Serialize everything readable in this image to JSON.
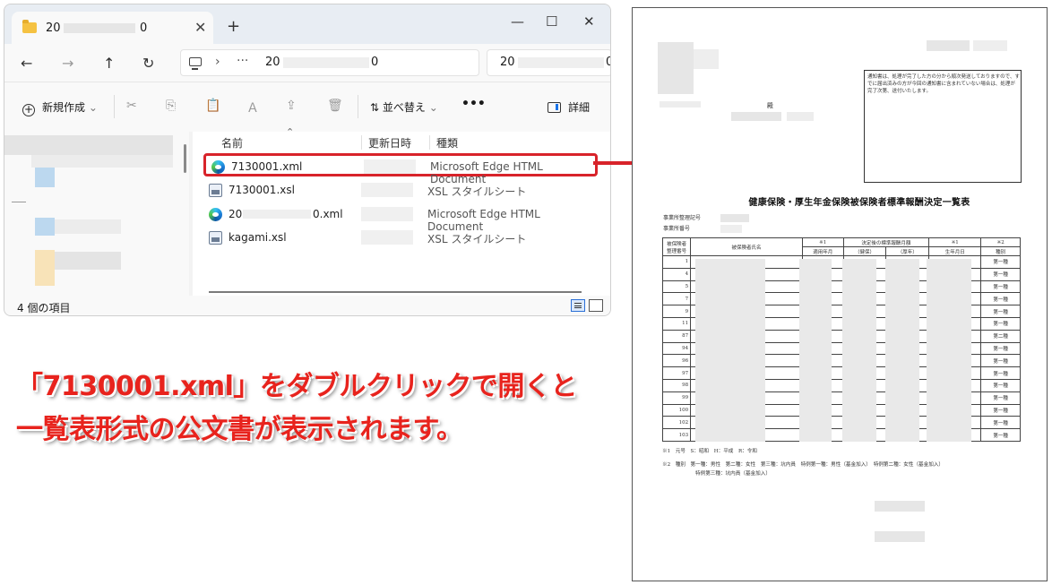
{
  "explorer": {
    "tab": {
      "title_prefix": "20",
      "title_suffix": "0",
      "close": "✕",
      "new_tab": "+"
    },
    "window_controls": {
      "minimize": "—",
      "maximize": "☐",
      "close": "✕"
    },
    "nav": {
      "back": "←",
      "forward": "→",
      "up": "↑",
      "refresh": "↻"
    },
    "address": {
      "separator": "›",
      "more": "···",
      "path_prefix": "20",
      "path_suffix": "0"
    },
    "search": {
      "prefix": "20",
      "suffix": "0"
    },
    "toolbar": {
      "new_label": "新規作成",
      "new_plus": "+",
      "new_caret": "⌄",
      "cut_icon": "✂",
      "copy_icon": "⎘",
      "paste_icon": "📋",
      "rename_icon": "Ａ",
      "share_icon": "⇪",
      "delete_icon": "🗑",
      "sort_label": "並べ替え",
      "sort_icon": "⇅",
      "sort_caret": "⌄",
      "more": "•••",
      "details_label": "詳細"
    },
    "columns": {
      "name": "名前",
      "modified": "更新日時",
      "type": "種類",
      "sort_caret": "⌃"
    },
    "files": [
      {
        "name": "7130001.xml",
        "name_suffix": "",
        "type": "Microsoft Edge HTML Document",
        "icon": "edge-icon",
        "selected": true
      },
      {
        "name": "7130001.xsl",
        "name_suffix": "",
        "type": "XSL スタイルシート",
        "icon": "xsl-icon",
        "selected": false
      },
      {
        "name": "20",
        "name_suffix": "0.xml",
        "type": "Microsoft Edge HTML Document",
        "icon": "edge-icon",
        "selected": false
      },
      {
        "name": "kagami.xsl",
        "name_suffix": "",
        "type": "XSL スタイルシート",
        "icon": "xsl-icon",
        "selected": false
      }
    ],
    "status": {
      "count": "4 個の項目"
    }
  },
  "caption": {
    "line1": "「7130001.xml」をダブルクリックで開くと",
    "line2": "一覧表形式の公文書が表示されます。"
  },
  "document": {
    "recipient_suffix": "殿",
    "notice": "通知書は、処理が完了した方の分から順次発送しておりますので、すでに届出済みの方が今回の通知書に含まれていない場合は、処理が完了次第、送付いたします。",
    "title": "健康保険・厚生年金保険被保険者標準報酬決定一覧表",
    "office_code_label": "事業所整理記号",
    "office_number_label": "事業所番号",
    "header": {
      "insured_number": "被保険者\n整理番号",
      "insured_name": "被保険者氏名",
      "note1a": "※1",
      "applicable_month": "適用年月",
      "decided_std": "決定後の標準報酬月額",
      "health": "（健保）",
      "pension": "（厚年）",
      "note1b": "※1",
      "birth_date": "生年月日",
      "note2": "※2",
      "kind": "種別"
    },
    "rows": [
      {
        "no": "1",
        "kind": "第一種"
      },
      {
        "no": "4",
        "kind": "第一種"
      },
      {
        "no": "5",
        "kind": "第一種"
      },
      {
        "no": "7",
        "kind": "第一種"
      },
      {
        "no": "9",
        "kind": "第一種"
      },
      {
        "no": "11",
        "kind": "第一種"
      },
      {
        "no": "87",
        "kind": "第二種"
      },
      {
        "no": "94",
        "kind": "第一種"
      },
      {
        "no": "96",
        "kind": "第一種"
      },
      {
        "no": "97",
        "kind": "第一種"
      },
      {
        "no": "98",
        "kind": "第一種"
      },
      {
        "no": "99",
        "kind": "第一種"
      },
      {
        "no": "100",
        "kind": "第一種"
      },
      {
        "no": "102",
        "kind": "第一種"
      },
      {
        "no": "103",
        "kind": "第一種"
      }
    ],
    "footnote1": "※1　元号　S：昭和　H：平成　R：令和",
    "footnote2": "※2　種別　第一種：男性　第二種：女性　第三種：坑内員　特例第一種：男性（基金加入）　特例第二種：女性（基金加入）",
    "footnote3": "特例第三種：坑内員（基金加入）"
  },
  "colors": {
    "accent_red": "#d8232a",
    "caption_red": "#e8231d"
  }
}
